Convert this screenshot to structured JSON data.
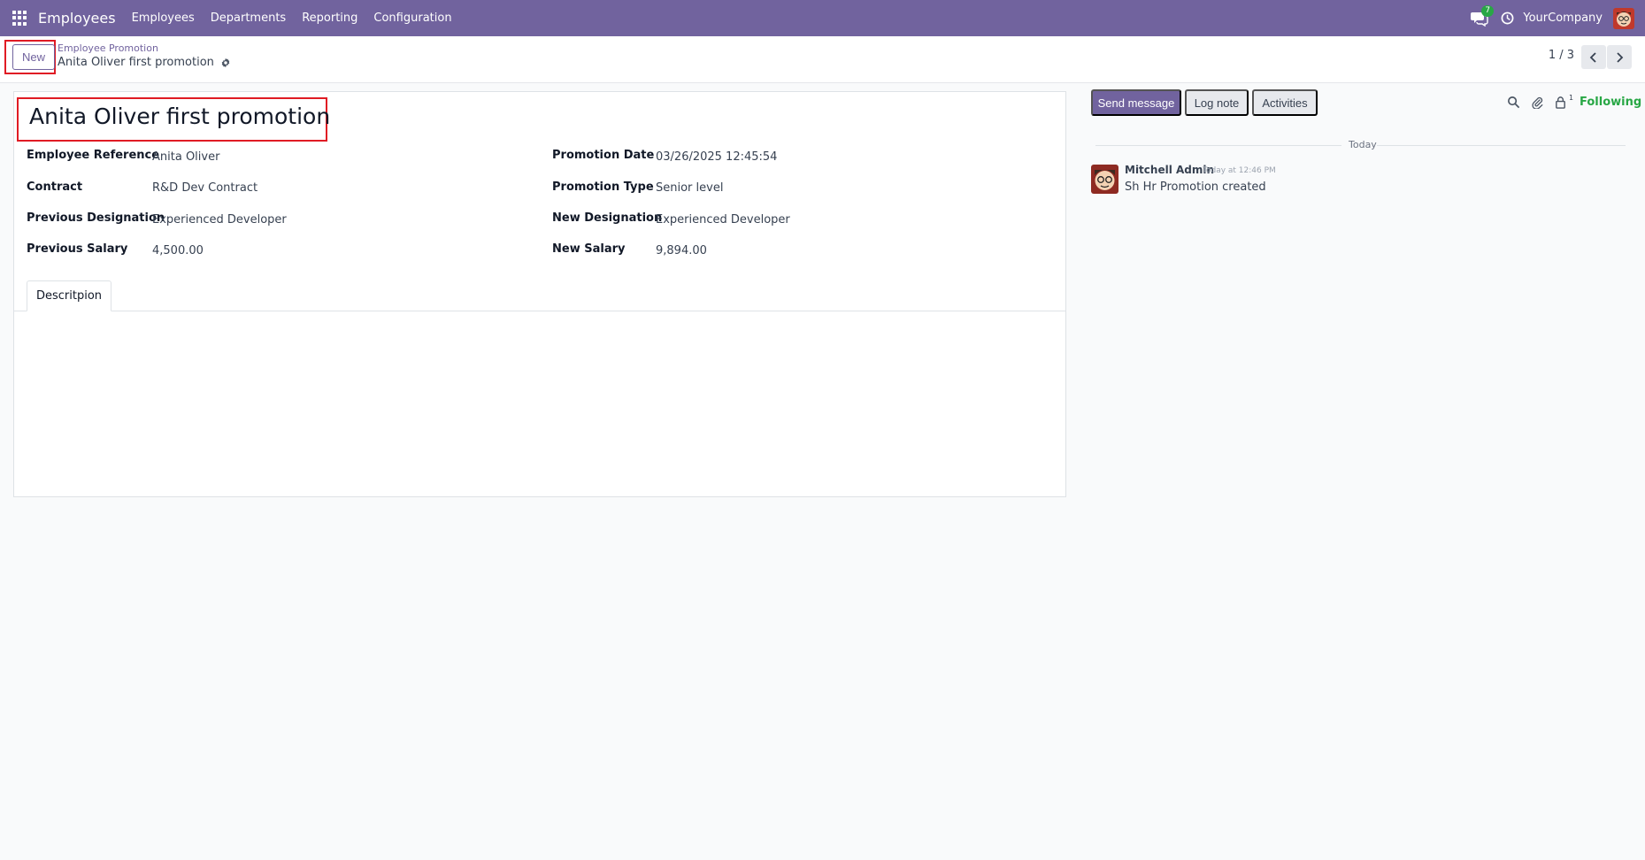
{
  "navbar": {
    "app_name": "Employees",
    "menu": [
      "Employees",
      "Departments",
      "Reporting",
      "Configuration"
    ],
    "chat_badge": "7",
    "company": "YourCompany",
    "bg_color": "#71639e"
  },
  "control_panel": {
    "new_button": "New",
    "breadcrumb_parent": "Employee Promotion",
    "breadcrumb_current": "Anita Oliver first promotion",
    "pager": "1 / 3"
  },
  "form": {
    "title": "Anita Oliver first promotion",
    "left_fields": [
      {
        "label": "Employee Reference",
        "value": "Anita Oliver"
      },
      {
        "label": "Contract",
        "value": "R&D Dev Contract"
      },
      {
        "label": "Previous Designation",
        "value": "Experienced Developer"
      },
      {
        "label": "Previous Salary",
        "value": "4,500.00"
      }
    ],
    "right_fields": [
      {
        "label": "Promotion Date",
        "value": "03/26/2025 12:45:54"
      },
      {
        "label": "Promotion Type",
        "value": "Senior level"
      },
      {
        "label": "New Designation",
        "value": "Experienced Developer"
      },
      {
        "label": "New Salary",
        "value": "9,894.00"
      }
    ],
    "tab_label": "Descritpion"
  },
  "chatter": {
    "send_message": "Send message",
    "log_note": "Log note",
    "activities": "Activities",
    "follower_count": "1",
    "following": "Following",
    "date_separator": "Today",
    "message": {
      "author": "Mitchell Admin",
      "time": "Today at 12:46 PM",
      "body": "Sh Hr Promotion created"
    }
  }
}
